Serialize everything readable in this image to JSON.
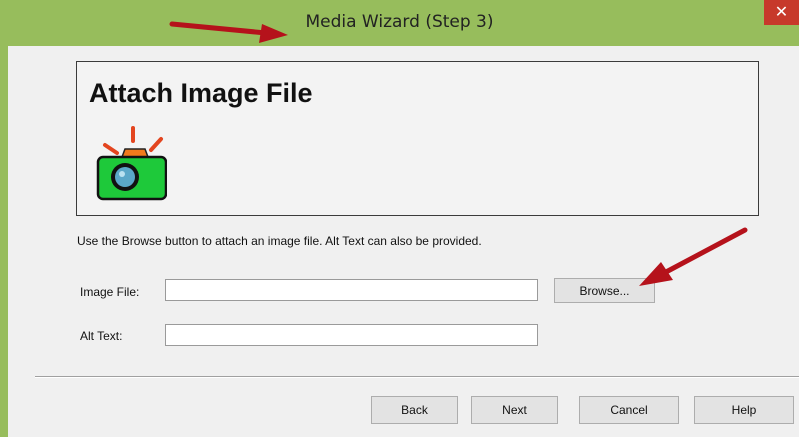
{
  "window": {
    "title": "Media Wizard (Step 3)",
    "close_glyph": "✕"
  },
  "header": {
    "title": "Attach Image File",
    "icon": "camera-icon"
  },
  "instructions": "Use the Browse button to attach an image file.  Alt Text can also be provided.",
  "form": {
    "image_file_label": "Image File:",
    "image_file_value": "",
    "browse_label": "Browse...",
    "alt_text_label": "Alt Text:",
    "alt_text_value": ""
  },
  "footer": {
    "back": "Back",
    "next": "Next",
    "cancel": "Cancel",
    "help": "Help"
  },
  "colors": {
    "title_bar": "#97bd5c",
    "close_button": "#c7392b",
    "annotation_arrow": "#b5121b"
  }
}
